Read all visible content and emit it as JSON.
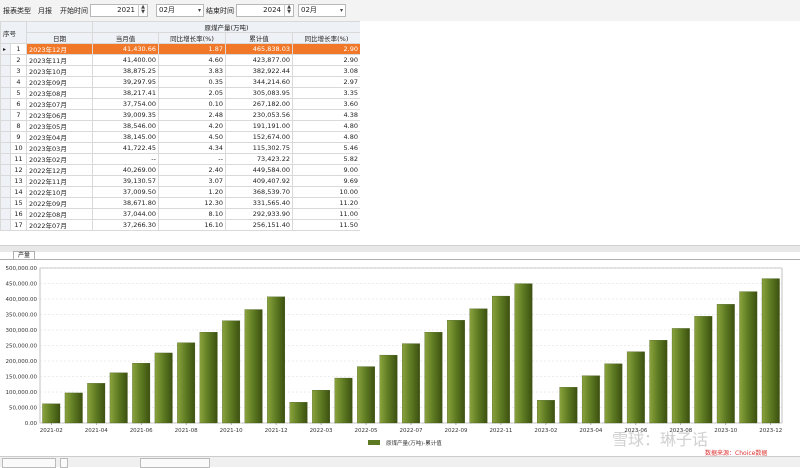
{
  "toolbar": {
    "report_type_label": "报表类型",
    "report_type_value": "月报",
    "start_label": "开始时间",
    "start_year": "2021",
    "start_month": "02月",
    "end_label": "结束时间",
    "end_year": "2024",
    "end_month": "02月"
  },
  "table": {
    "header_index": "序号",
    "header_group": "原煤产量(万吨)",
    "headers": [
      "日期",
      "当月值",
      "同比增长率(%)",
      "累计值",
      "同比增长率(%)"
    ],
    "row_indicator": "▸",
    "rows": [
      {
        "idx": "1",
        "date": "2023年12月",
        "month": "41,430.66",
        "yoy": "1.87",
        "cum": "465,838.03",
        "cum_yoy": "2.90"
      },
      {
        "idx": "2",
        "date": "2023年11月",
        "month": "41,400.00",
        "yoy": "4.60",
        "cum": "423,877.00",
        "cum_yoy": "2.90"
      },
      {
        "idx": "3",
        "date": "2023年10月",
        "month": "38,875.25",
        "yoy": "3.83",
        "cum": "382,922.44",
        "cum_yoy": "3.08"
      },
      {
        "idx": "4",
        "date": "2023年09月",
        "month": "39,297.95",
        "yoy": "0.35",
        "cum": "344,214.60",
        "cum_yoy": "2.97"
      },
      {
        "idx": "5",
        "date": "2023年08月",
        "month": "38,217.41",
        "yoy": "2.05",
        "cum": "305,083.95",
        "cum_yoy": "3.35"
      },
      {
        "idx": "6",
        "date": "2023年07月",
        "month": "37,754.00",
        "yoy": "0.10",
        "cum": "267,182.00",
        "cum_yoy": "3.60"
      },
      {
        "idx": "7",
        "date": "2023年06月",
        "month": "39,009.35",
        "yoy": "2.48",
        "cum": "230,053.56",
        "cum_yoy": "4.38"
      },
      {
        "idx": "8",
        "date": "2023年05月",
        "month": "38,546.00",
        "yoy": "4.20",
        "cum": "191,191.00",
        "cum_yoy": "4.80"
      },
      {
        "idx": "9",
        "date": "2023年04月",
        "month": "38,145.00",
        "yoy": "4.50",
        "cum": "152,674.00",
        "cum_yoy": "4.80"
      },
      {
        "idx": "10",
        "date": "2023年03月",
        "month": "41,722.45",
        "yoy": "4.34",
        "cum": "115,302.75",
        "cum_yoy": "5.46"
      },
      {
        "idx": "11",
        "date": "2023年02月",
        "month": "--",
        "yoy": "--",
        "cum": "73,423.22",
        "cum_yoy": "5.82"
      },
      {
        "idx": "12",
        "date": "2022年12月",
        "month": "40,269.00",
        "yoy": "2.40",
        "cum": "449,584.00",
        "cum_yoy": "9.00"
      },
      {
        "idx": "13",
        "date": "2022年11月",
        "month": "39,130.57",
        "yoy": "3.07",
        "cum": "409,407.92",
        "cum_yoy": "9.69"
      },
      {
        "idx": "14",
        "date": "2022年10月",
        "month": "37,009.50",
        "yoy": "1.20",
        "cum": "368,539.70",
        "cum_yoy": "10.00"
      },
      {
        "idx": "15",
        "date": "2022年09月",
        "month": "38,671.80",
        "yoy": "12.30",
        "cum": "331,565.40",
        "cum_yoy": "11.20"
      },
      {
        "idx": "16",
        "date": "2022年08月",
        "month": "37,044.00",
        "yoy": "8.10",
        "cum": "292,933.90",
        "cum_yoy": "11.00"
      },
      {
        "idx": "17",
        "date": "2022年07月",
        "month": "37,266.30",
        "yoy": "16.10",
        "cum": "256,151.40",
        "cum_yoy": "11.50"
      }
    ]
  },
  "chart_tab_label": "产量",
  "watermark": {
    "brand": "雪球：琳子话",
    "source": "数据来源：Choice数据"
  },
  "colors": {
    "bar": "#5d7a22",
    "selected_row": "#f07828"
  },
  "chart_data": {
    "type": "bar",
    "categories": [
      "2021-02",
      "2021-03",
      "2021-04",
      "2021-05",
      "2021-06",
      "2021-07",
      "2021-08",
      "2021-09",
      "2021-10",
      "2021-11",
      "2021-12",
      "2022-02",
      "2022-03",
      "2022-04",
      "2022-05",
      "2022-06",
      "2022-07",
      "2022-08",
      "2022-09",
      "2022-10",
      "2022-11",
      "2022-12",
      "2023-02",
      "2023-03",
      "2023-04",
      "2023-05",
      "2023-06",
      "2023-07",
      "2023-08",
      "2023-09",
      "2023-10",
      "2023-11",
      "2023-12"
    ],
    "tick_labels": [
      "2021-02",
      "2021-04",
      "2021-06",
      "2021-08",
      "2021-10",
      "2021-12",
      "2022-03",
      "2022-05",
      "2022-07",
      "2022-09",
      "2022-11",
      "2023-02",
      "2023-04",
      "2023-06",
      "2023-08",
      "2023-10",
      "2023-12"
    ],
    "series": [
      {
        "name": "原煤产量(万吨)-累计值",
        "values": [
          62000,
          97000,
          128000,
          162000,
          193000,
          226000,
          259000,
          293000,
          330000,
          366000,
          407000,
          67000,
          106000,
          145000,
          182000,
          219000,
          256151.4,
          292933.9,
          331565.4,
          368539.7,
          409407.92,
          449584,
          73423.22,
          115302.75,
          152674,
          191191,
          230053.56,
          267182,
          305083.95,
          344214.6,
          382922.44,
          423877,
          465838.03
        ]
      }
    ],
    "ylim": [
      0,
      500000
    ],
    "yticks": [
      "0.00",
      "50,000.00",
      "100,000.00",
      "150,000.00",
      "200,000.00",
      "250,000.00",
      "300,000.00",
      "350,000.00",
      "400,000.00",
      "450,000.00",
      "500,000.00"
    ],
    "grid": true,
    "legend": "bottom-center"
  }
}
